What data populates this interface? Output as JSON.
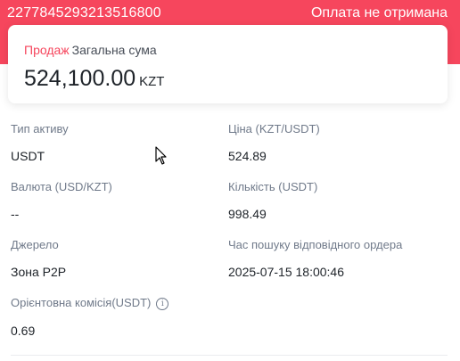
{
  "header": {
    "order_number": "2277845293213516800",
    "status": "Оплата не отримана"
  },
  "summary": {
    "side": "Продаж",
    "label": "Загальна сума",
    "amount": "524,100.00",
    "currency": "KZT"
  },
  "details": {
    "asset_type": {
      "label": "Тип активу",
      "value": "USDT"
    },
    "price": {
      "label": "Ціна (KZT/USDT)",
      "value": "524.89"
    },
    "currency": {
      "label": "Валюта (USD/KZT)",
      "value": "--"
    },
    "quantity": {
      "label": "Кількість (USDT)",
      "value": "998.49"
    },
    "source": {
      "label": "Джерело",
      "value": "Зона P2P"
    },
    "match_time": {
      "label": "Час пошуку відповідного ордера",
      "value": "2025-07-15 18:00:46"
    },
    "fee": {
      "label": "Орієнтовна комісія(USDT)",
      "value": "0.69",
      "icon": "info-icon"
    }
  },
  "colors": {
    "banner": "#f6465d",
    "sell": "#f6465d",
    "text": "#1e2329",
    "label": "#707a8a"
  }
}
